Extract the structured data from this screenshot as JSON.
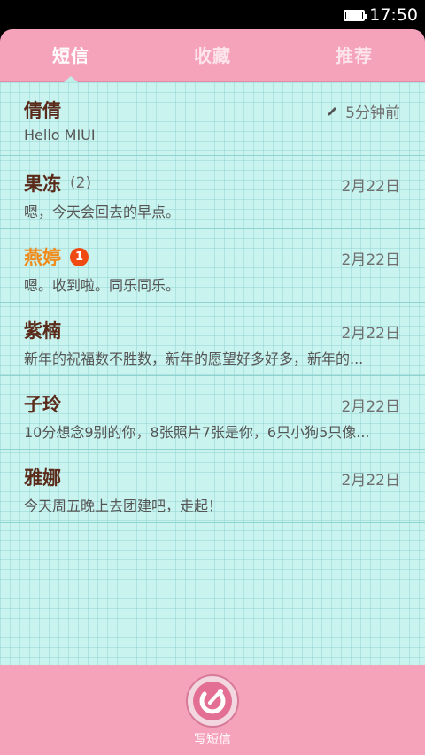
{
  "status_bar": {
    "time": "17:50",
    "battery_icon": "battery-icon"
  },
  "tabs": [
    {
      "label": "短信",
      "active": true
    },
    {
      "label": "收藏",
      "active": false
    },
    {
      "label": "推荐",
      "active": false
    }
  ],
  "messages": [
    {
      "name": "倩倩",
      "date": "5分钟前",
      "preview": "Hello MIUI",
      "draft": true
    },
    {
      "name": "果冻",
      "count": "(2)",
      "date": "2月22日",
      "preview": "嗯，今天会回去的早点。"
    },
    {
      "name": "燕婷",
      "unread": "1",
      "date": "2月22日",
      "preview": "嗯。收到啦。同乐同乐。"
    },
    {
      "name": "紫楠",
      "date": "2月22日",
      "preview": "新年的祝福数不胜数，新年的愿望好多好多，新年的..."
    },
    {
      "name": "子玲",
      "date": "2月22日",
      "preview": "10分想念9别的你，8张照片7张是你，6只小狗5只像..."
    },
    {
      "name": "雅娜",
      "date": "2月22日",
      "preview": "今天周五晚上去团建吧，走起！"
    }
  ],
  "compose": {
    "label": "写短信",
    "icon": "compose-icon"
  },
  "colors": {
    "accent_pink": "#f5a3bb",
    "list_bg": "#c9f3ee",
    "unread_orange": "#f08a1a",
    "badge_red": "#f04a12"
  }
}
